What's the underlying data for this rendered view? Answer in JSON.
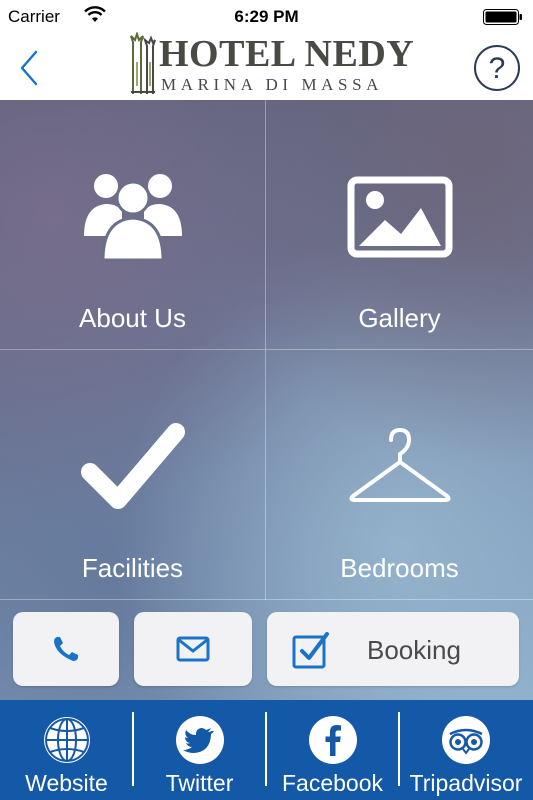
{
  "status_bar": {
    "carrier": "Carrier",
    "time": "6:29 PM"
  },
  "nav": {
    "logo_title": "HOTEL NEDY",
    "logo_subtitle": "MARINA DI MASSA",
    "help_label": "?"
  },
  "tiles": [
    {
      "label": "About Us",
      "icon": "group-icon"
    },
    {
      "label": "Gallery",
      "icon": "image-icon"
    },
    {
      "label": "Facilities",
      "icon": "checkmark-icon"
    },
    {
      "label": "Bedrooms",
      "icon": "hanger-icon"
    }
  ],
  "actions": {
    "phone_icon": "phone-icon",
    "mail_icon": "mail-icon",
    "booking_icon": "checkbox-icon",
    "booking_label": "Booking"
  },
  "social": [
    {
      "label": "Website",
      "icon": "globe-icon"
    },
    {
      "label": "Twitter",
      "icon": "twitter-icon"
    },
    {
      "label": "Facebook",
      "icon": "facebook-icon"
    },
    {
      "label": "Tripadvisor",
      "icon": "tripadvisor-icon"
    }
  ],
  "colors": {
    "accent_blue": "#1458a8",
    "action_icon_blue": "#1a73c8",
    "logo_text": "#4a4a44",
    "button_bg": "#f2f2f4"
  }
}
